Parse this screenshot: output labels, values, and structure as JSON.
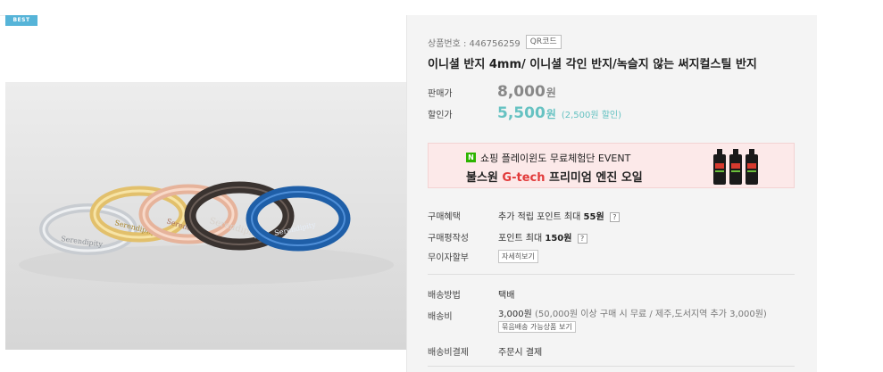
{
  "badge": {
    "label": "BEST"
  },
  "photo": {
    "rings": [
      {
        "color": "#cfd3d8",
        "engraving": "Serendipity"
      },
      {
        "color": "#e7c879",
        "engraving": "Serendipity"
      },
      {
        "color": "#e7b8a2",
        "engraving": "Serendipity"
      },
      {
        "color": "#3a3330",
        "engraving": "Serendipity"
      },
      {
        "color": "#1f5fa8",
        "engraving": "Serendipity"
      }
    ]
  },
  "product": {
    "code_text": "상품번호 : 446756259",
    "qr_label": "QR코드",
    "title": "이니셜 반지 4mm/ 이니셜 각인 반지/녹슬지 않는 써지컬스틸 반지"
  },
  "price": {
    "original_label": "판매가",
    "original_value": "8,000",
    "original_unit": "원",
    "sale_label": "할인가",
    "sale_value": "5,500",
    "sale_unit": "원",
    "discount_text": "(2,500원 할인)"
  },
  "banner": {
    "logo": "N",
    "line1": "쇼핑 플레이윈도 무료체험단 EVENT",
    "line2_prefix": "불스원",
    "line2_highlight": "G-tech",
    "line2_suffix": "프리미엄 엔진 오일"
  },
  "benefits": {
    "purchase_label": "구매혜택",
    "purchase_value_prefix": "추가 적립 포인트 최대",
    "purchase_value_bold": "55원",
    "review_label": "구매평작성",
    "review_value_prefix": "포인트 최대",
    "review_value_bold": "150원",
    "help": "?",
    "installment_label": "무이자할부",
    "installment_button": "자세히보기"
  },
  "shipping": {
    "method_label": "배송방법",
    "method_value": "택배",
    "cost_label": "배송비",
    "cost_value": "3,000원",
    "cost_note": "(50,000원 이상 구매 시 무료 / 제주,도서지역 추가 3,000원)",
    "bundle_button": "묶음배송 가능상품 보기",
    "payment_label": "배송비결제",
    "payment_value": "주문시 결제"
  }
}
